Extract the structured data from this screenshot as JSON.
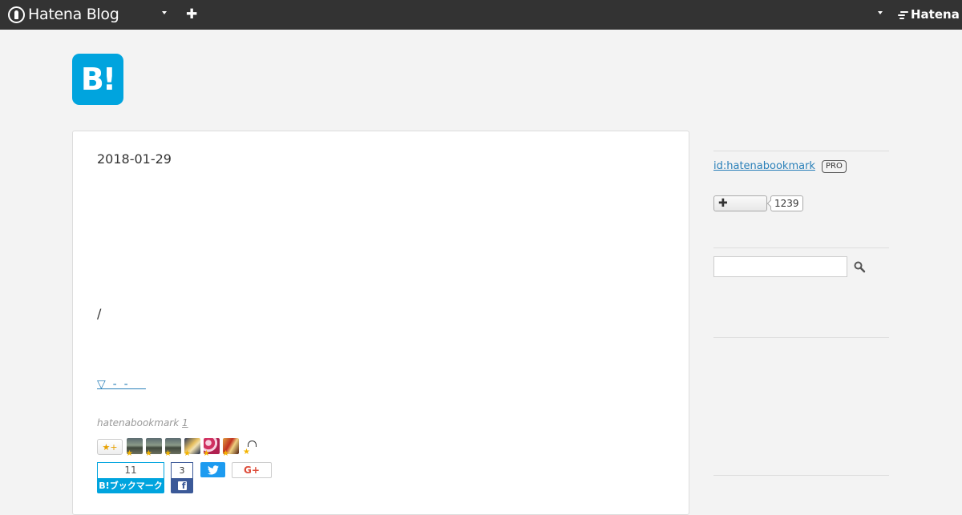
{
  "topbar": {
    "brand": "Hatena Blog",
    "service": "Hatena",
    "icons": [
      "hatena-blog-logo-icon",
      "chevron-down-icon",
      "plus-icon",
      "hatena-logo-icon"
    ]
  },
  "blog": {
    "logo_text": "B!",
    "colors": {
      "brand": "#00a4de",
      "link": "#2a80b9",
      "topbar": "#333333"
    }
  },
  "article": {
    "date": "2018-01-29",
    "body_fragment": "/",
    "more_link": "▽  -  -     ",
    "author_prefix": "hatenabookmark",
    "comment_count": "1",
    "star_add_label": "★+",
    "star_more": "ᷝ"
  },
  "share": {
    "hatena_count": "11",
    "hatena_label": "B!ブックマーク",
    "facebook_count": "3",
    "facebook_label": "f",
    "googleplus_label": "G+"
  },
  "sidebar": {
    "user_id": "id:hatenabookmark",
    "badge": "PRO",
    "follow_label": "✚",
    "follower_count": "1239",
    "search_placeholder": ""
  }
}
